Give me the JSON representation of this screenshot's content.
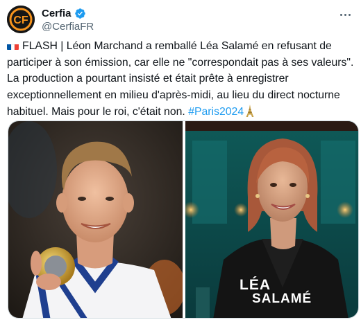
{
  "author": {
    "display_name": "Cerfia",
    "handle": "@CerfiaFR",
    "avatar_text": "CF",
    "avatar_icon": "cerfia-logo-icon",
    "verified_icon": "verified-badge-icon"
  },
  "more_icon": "more-options-icon",
  "tweet": {
    "flag_icon": "france-flag-icon",
    "text": "FLASH | Léon Marchand a remballé Léa Salamé en refusant de participer à son émission, car elle ne \"correspondait pas à ses valeurs\". La production a pourtant insisté et était prête à enregistrer exceptionnellement en milieu d'après-midi, au lieu du direct nocturne habituel. Mais pour le roi, c'était non.",
    "hashtag": "#Paris2024",
    "tower_icon": "eiffel-tower-icon"
  },
  "media": {
    "left_photo": "swimmer-with-medal-photo",
    "right_photo": "tv-presenter-photo",
    "caption_line1": "LÉA",
    "caption_line2": "SALAMÉ"
  },
  "colors": {
    "link": "#1d9bf0",
    "verified": "#1d9bf0",
    "avatar_orange": "#f7941d",
    "text": "#0f1419",
    "secondary": "#536471"
  }
}
